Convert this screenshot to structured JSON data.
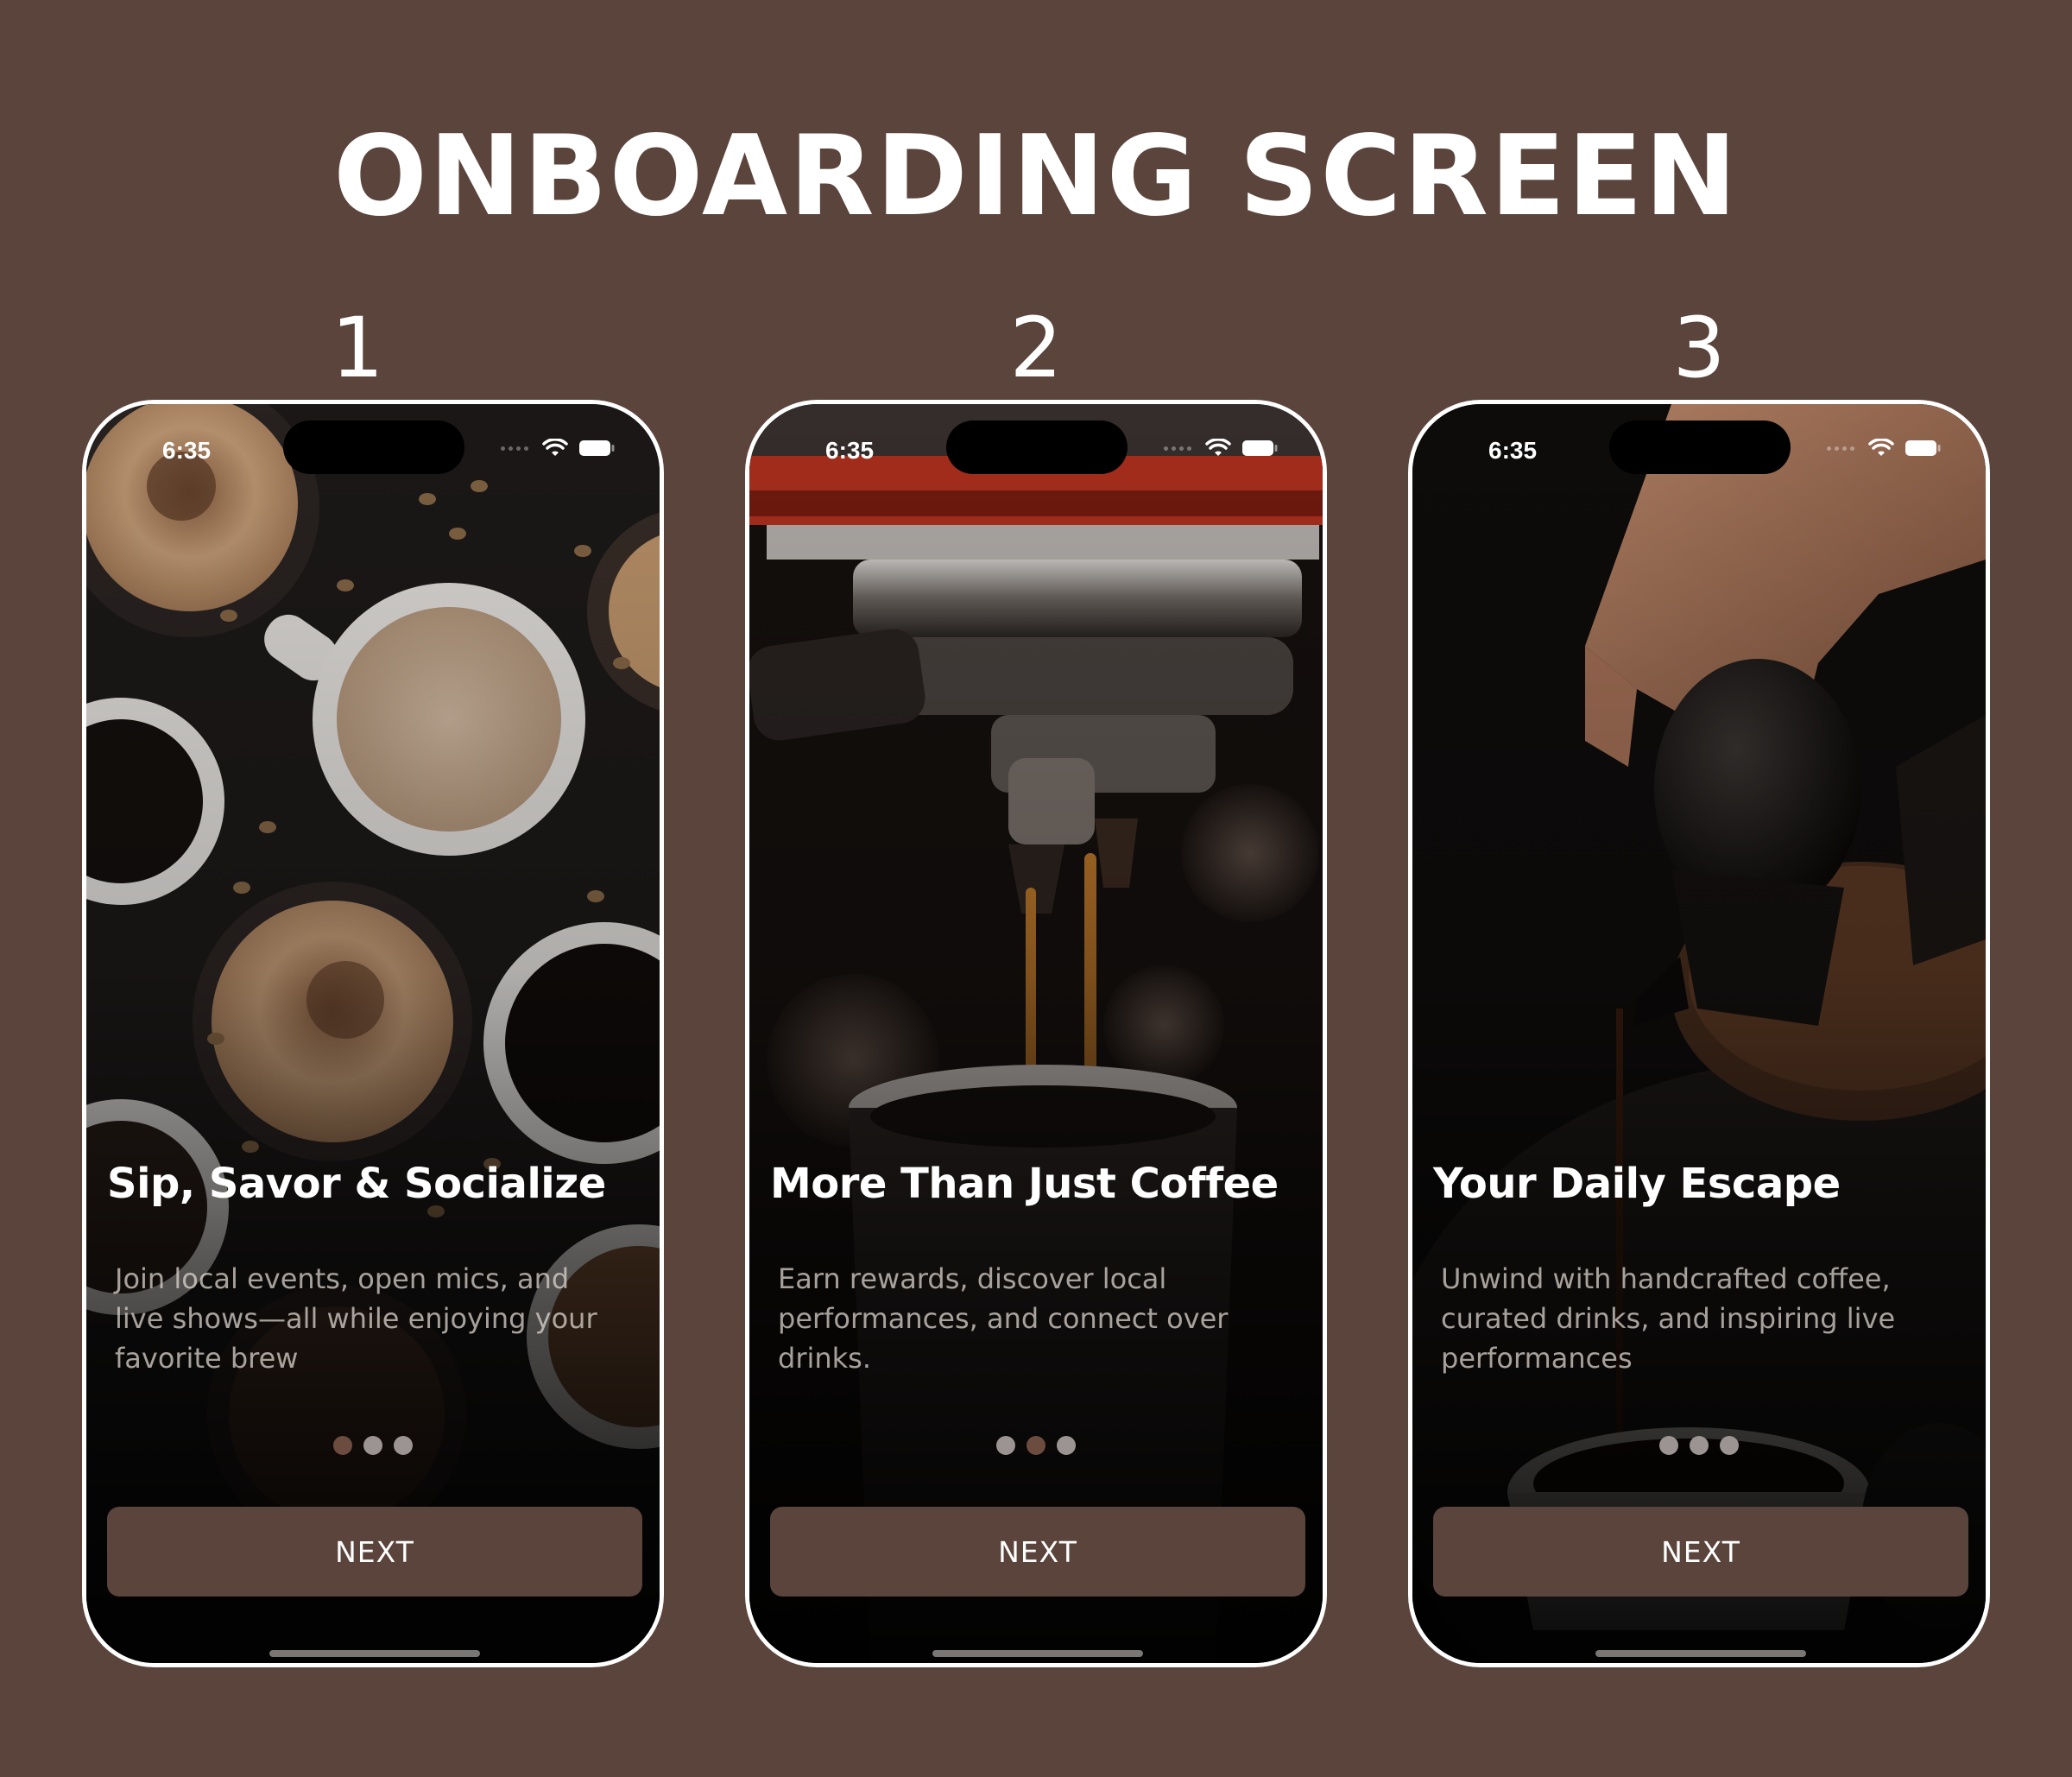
{
  "page": {
    "title": "ONBOARDING SCREEN"
  },
  "status_bar": {
    "time": "6:35",
    "icons": [
      "cellular-icon",
      "wifi-icon",
      "battery-icon"
    ]
  },
  "screens": [
    {
      "number": "1",
      "title": "Sip, Savor & Socialize",
      "description": "Join local events, open mics, and live shows—all while enjoying your favorite brew",
      "active_dot": 0,
      "button_label": "NEXT"
    },
    {
      "number": "2",
      "title": "More Than Just Coffee",
      "description": "Earn rewards, discover local performances, and connect over drinks.",
      "active_dot": 1,
      "button_label": "NEXT"
    },
    {
      "number": "3",
      "title": "Your Daily Escape",
      "description": "Unwind with handcrafted coffee, curated drinks, and inspiring live performances",
      "active_dot": 2,
      "button_label": "NEXT"
    }
  ],
  "colors": {
    "background": "#5a443b",
    "button": "#5a443b",
    "active_dot": "#6b4c3f",
    "inactive_dot": "#9b9492"
  }
}
